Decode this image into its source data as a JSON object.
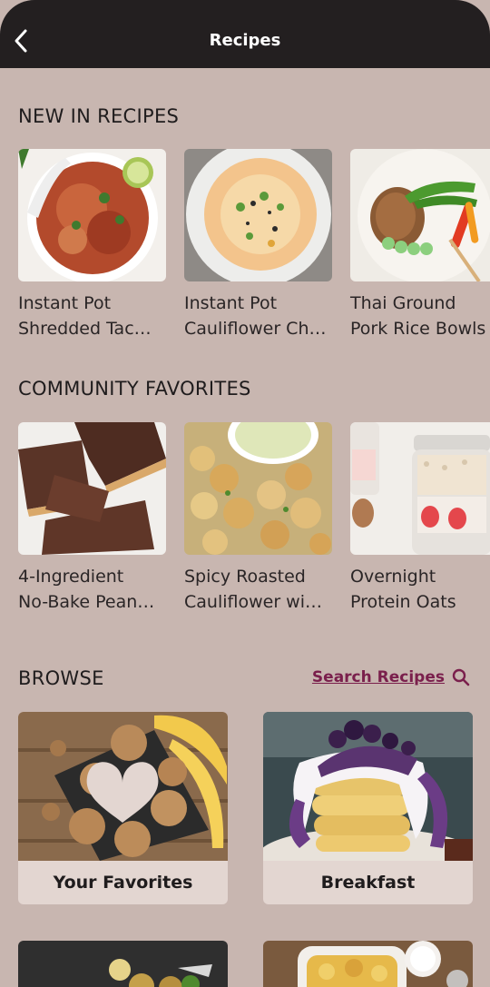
{
  "header": {
    "title": "Recipes",
    "back_icon": "chevron-left-icon"
  },
  "new_in": {
    "title": "NEW IN RECIPES",
    "items": [
      {
        "title": "Instant Pot\nShredded Tac…"
      },
      {
        "title": "Instant Pot\nCauliflower Ch…"
      },
      {
        "title": "Thai Ground\nPork Rice Bowls"
      }
    ]
  },
  "community": {
    "title": "COMMUNITY FAVORITES",
    "items": [
      {
        "title": "4-Ingredient\nNo-Bake Pean…"
      },
      {
        "title": "Spicy Roasted\nCauliflower wi…"
      },
      {
        "title": "Overnight\nProtein Oats"
      }
    ]
  },
  "browse": {
    "title": "BROWSE",
    "search_label": "Search Recipes",
    "search_icon": "search-icon",
    "categories": [
      {
        "label": "Your Favorites"
      },
      {
        "label": "Breakfast"
      }
    ]
  },
  "colors": {
    "background": "#c8b6b0",
    "header": "#231f20",
    "accent": "#7a1f4c",
    "card": "#e3d6d1"
  }
}
